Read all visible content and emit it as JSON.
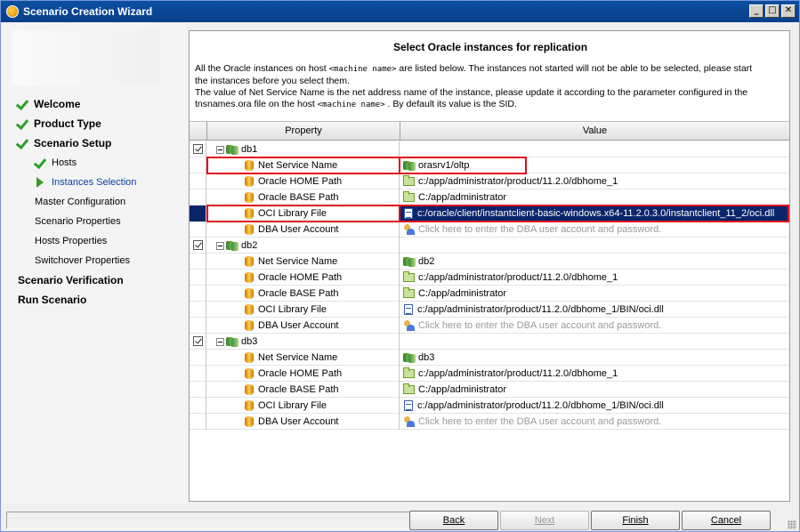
{
  "window": {
    "title": "Scenario Creation Wizard",
    "controls": [
      "_",
      "□",
      "✕"
    ]
  },
  "nav": [
    {
      "label": "Welcome",
      "state": "done",
      "level": 1
    },
    {
      "label": "Product Type",
      "state": "done",
      "level": 1
    },
    {
      "label": "Scenario Setup",
      "state": "done",
      "level": 1
    },
    {
      "label": "Hosts",
      "state": "done",
      "level": 2
    },
    {
      "label": "Instances Selection",
      "state": "current",
      "level": 2
    },
    {
      "label": "Master Configuration",
      "state": "pending",
      "level": 2
    },
    {
      "label": "Scenario Properties",
      "state": "pending",
      "level": 2
    },
    {
      "label": "Hosts Properties",
      "state": "pending",
      "level": 2
    },
    {
      "label": "Switchover Properties",
      "state": "pending",
      "level": 2
    },
    {
      "label": "Scenario Verification",
      "state": "pending",
      "level": 1
    },
    {
      "label": "Run Scenario",
      "state": "pending",
      "level": 1
    }
  ],
  "main": {
    "heading": "Select Oracle instances for replication",
    "desc1a": "All the Oracle instances on host",
    "desc1_host": "<machine name>",
    "desc1b": "are listed below. The instances not started will not be able to be selected, please start",
    "desc2": "the instances before you select them.",
    "desc3": "The value of Net Service Name is the net address name of the instance, please update it according to the parameter configured in the",
    "desc4a": "tnsnames.ora file on the host",
    "desc4_host": "<machine name>",
    "desc4b": ". By default its value is the SID."
  },
  "grid": {
    "columns": {
      "property": "Property",
      "value": "Value"
    },
    "instances": [
      {
        "name": "db1",
        "checked": true,
        "rows": [
          {
            "prop": "Net Service Name",
            "value": "orasrv1/oltp",
            "icon": "db-icon"
          },
          {
            "prop": "Oracle HOME Path",
            "value": "c:/app/administrator/product/11.2.0/dbhome_1",
            "icon": "folder-icon"
          },
          {
            "prop": "Oracle BASE Path",
            "value": "C:/app/administrator",
            "icon": "folder-icon"
          },
          {
            "prop": "OCI Library File",
            "value": "c:/oracle/client/instantclient-basic-windows.x64-11.2.0.3.0/instantclient_11_2/oci.dll",
            "icon": "file-icon",
            "selected": true
          },
          {
            "prop": "DBA User Account",
            "value": "Click here to enter the DBA user account and password.",
            "icon": "user-icon",
            "hint": true
          }
        ]
      },
      {
        "name": "db2",
        "checked": true,
        "rows": [
          {
            "prop": "Net Service Name",
            "value": "db2",
            "icon": "db-icon"
          },
          {
            "prop": "Oracle HOME Path",
            "value": "c:/app/administrator/product/11.2.0/dbhome_1",
            "icon": "folder-icon"
          },
          {
            "prop": "Oracle BASE Path",
            "value": "C:/app/administrator",
            "icon": "folder-icon"
          },
          {
            "prop": "OCI Library File",
            "value": "c:/app/administrator/product/11.2.0/dbhome_1/BIN/oci.dll",
            "icon": "file-icon"
          },
          {
            "prop": "DBA User Account",
            "value": "Click here to enter the DBA user account and password.",
            "icon": "user-icon",
            "hint": true
          }
        ]
      },
      {
        "name": "db3",
        "checked": true,
        "rows": [
          {
            "prop": "Net Service Name",
            "value": "db3",
            "icon": "db-icon"
          },
          {
            "prop": "Oracle HOME Path",
            "value": "c:/app/administrator/product/11.2.0/dbhome_1",
            "icon": "folder-icon"
          },
          {
            "prop": "Oracle BASE Path",
            "value": "C:/app/administrator",
            "icon": "folder-icon"
          },
          {
            "prop": "OCI Library File",
            "value": "c:/app/administrator/product/11.2.0/dbhome_1/BIN/oci.dll",
            "icon": "file-icon"
          },
          {
            "prop": "DBA User Account",
            "value": "Click here to enter the DBA user account and password.",
            "icon": "user-icon",
            "hint": true
          }
        ]
      }
    ]
  },
  "buttons": {
    "back": "Back",
    "next": "Next",
    "finish": "Finish",
    "cancel": "Cancel"
  },
  "colors": {
    "title_bar": "#0a4fa0",
    "selection": "#0a246a",
    "highlight_box": "#e0101a",
    "done_check": "#2aa12a"
  }
}
